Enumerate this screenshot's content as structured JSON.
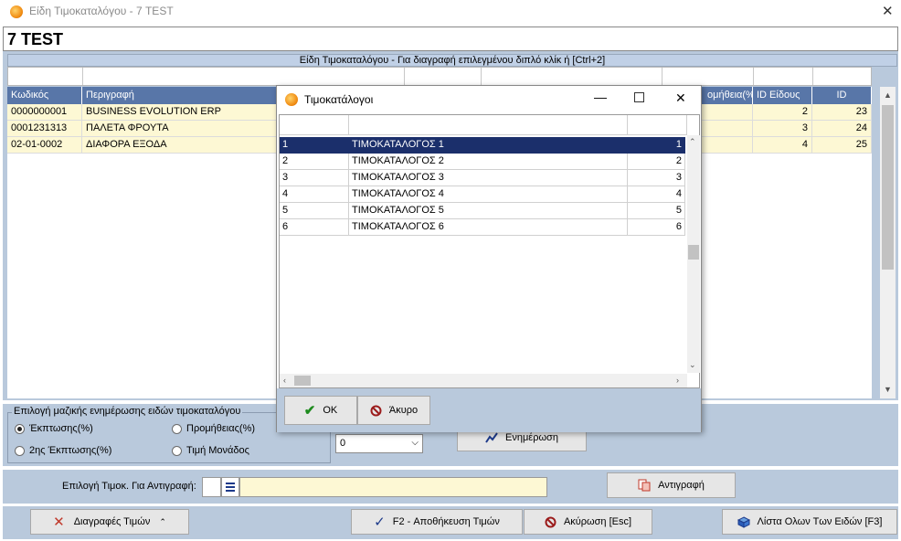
{
  "window": {
    "title": "Είδη Τιμοκαταλόγου - 7  TEST",
    "header": "7  TEST"
  },
  "grid": {
    "caption": "Είδη Τιμοκαταλόγου - Για διαγραφή επιλεγμένου διπλό κλίκ ή [Ctrl+2]",
    "columns": [
      "Κωδικός",
      "Περιγραφή",
      "ομήθεια(%)",
      "ID Είδους",
      "ID"
    ],
    "rows": [
      {
        "code": "0000000001",
        "desc": "BUSINESS EVOLUTION ERP",
        "id_eidous": "2",
        "id": "23"
      },
      {
        "code": "0001231313",
        "desc": "ΠΑΛΕΤΑ ΦΡΟΥΤΑ",
        "id_eidous": "3",
        "id": "24"
      },
      {
        "code": "02-01-0002",
        "desc": "ΔΙΑΦΟΡΑ ΕΞΟΔΑ",
        "id_eidous": "4",
        "id": "25"
      }
    ]
  },
  "mass_update": {
    "legend": "Επιλογή μαζικής ενημέρωσης ειδών τιμοκαταλόγου",
    "options": [
      "Έκπτωσης(%)",
      "2ης Έκπτωσης(%)",
      "Προμήθειας(%)",
      "Τιμή Μονάδος"
    ],
    "combo_value": "0",
    "update_button": "Ενημέρωση"
  },
  "copy": {
    "label": "Επιλογή Τιμοκ. Για Αντιγραφή:",
    "button": "Αντιγραφή"
  },
  "toolbar": {
    "delete": "Διαγραφές Τιμών",
    "save": "F2 - Αποθήκευση Τιμών",
    "cancel": "Ακύρωση [Esc]",
    "list": "Λίστα Ολων Των Ειδών [F3]"
  },
  "dialog": {
    "title": "Τιμοκατάλογοι",
    "rows": [
      {
        "n": "1",
        "name": "ΤΙΜΟΚΑΤΑΛΟΓΟΣ 1",
        "id": "1"
      },
      {
        "n": "2",
        "name": "ΤΙΜΟΚΑΤΑΛΟΓΟΣ 2",
        "id": "2"
      },
      {
        "n": "3",
        "name": "ΤΙΜΟΚΑΤΑΛΟΓΟΣ 3",
        "id": "3"
      },
      {
        "n": "4",
        "name": "ΤΙΜΟΚΑΤΑΛΟΓΟΣ 4",
        "id": "4"
      },
      {
        "n": "5",
        "name": "ΤΙΜΟΚΑΤΑΛΟΓΟΣ 5",
        "id": "5"
      },
      {
        "n": "6",
        "name": "ΤΙΜΟΚΑΤΑΛΟΓΟΣ 6",
        "id": "6"
      }
    ],
    "ok": "OK",
    "cancel": "Άκυρο"
  },
  "colors": {
    "header_blue": "#5876a8",
    "panel": "#b9c9dc",
    "selected_row": "#1b2f6b",
    "row_yellow": "#fdf8d4"
  }
}
